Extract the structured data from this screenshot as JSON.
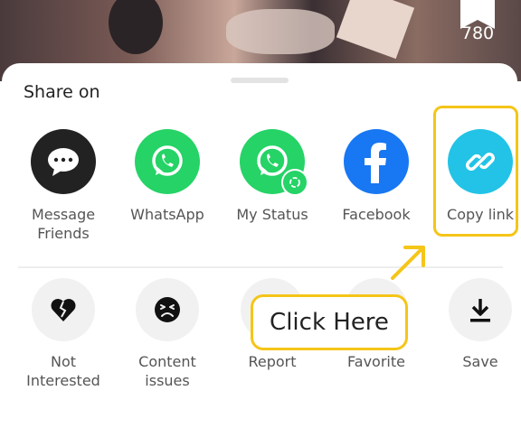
{
  "video": {
    "bookmark_count": "780"
  },
  "sheet": {
    "title": "Share on",
    "share_targets": [
      {
        "label": "Message Friends",
        "icon": "message-icon",
        "color": "#222222"
      },
      {
        "label": "WhatsApp",
        "icon": "whatsapp-icon",
        "color": "#25D366"
      },
      {
        "label": "My Status",
        "icon": "whatsapp-status-icon",
        "color": "#25D366"
      },
      {
        "label": "Facebook",
        "icon": "facebook-icon",
        "color": "#1877F2"
      },
      {
        "label": "Copy link",
        "icon": "link-icon",
        "color": "#22C3E6"
      }
    ],
    "actions": [
      {
        "label": "Not Interested",
        "icon": "broken-heart-icon"
      },
      {
        "label": "Content issues",
        "icon": "sad-face-icon"
      },
      {
        "label": "Report",
        "icon": "flag-icon"
      },
      {
        "label": "Favorite",
        "icon": "star-icon"
      },
      {
        "label": "Save",
        "icon": "download-icon"
      }
    ]
  },
  "annotation": {
    "tooltip_text": "Click Here",
    "accent": "#F5C518"
  }
}
